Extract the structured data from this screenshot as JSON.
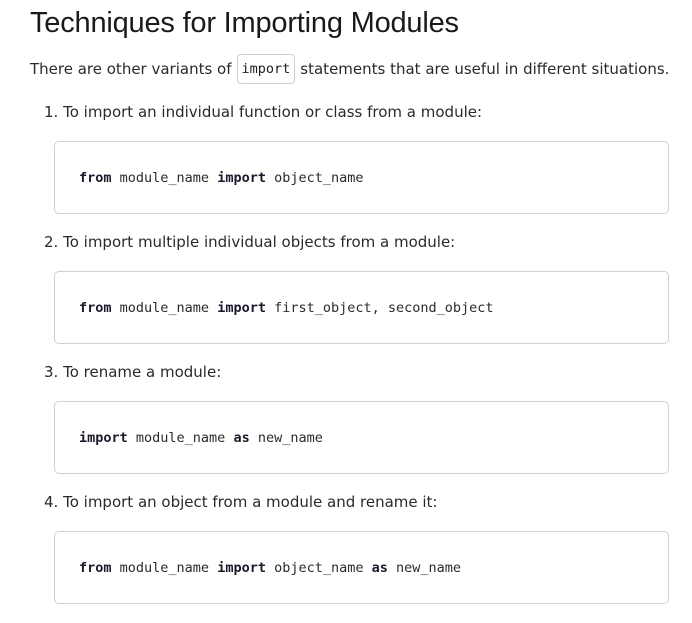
{
  "heading": "Techniques for Importing Modules",
  "intro": {
    "before": "There are other variants of",
    "code": "import",
    "after": "statements that are useful in different situations."
  },
  "steps": [
    {
      "number": "1.",
      "label": "To import an individual function or class from a module:",
      "code": [
        {
          "type": "kw",
          "text": "from"
        },
        {
          "type": "tok",
          "text": " module_name "
        },
        {
          "type": "kw",
          "text": "import"
        },
        {
          "type": "tok",
          "text": " object_name"
        }
      ]
    },
    {
      "number": "2.",
      "label": "To import multiple individual objects from a module:",
      "code": [
        {
          "type": "kw",
          "text": "from"
        },
        {
          "type": "tok",
          "text": " module_name "
        },
        {
          "type": "kw",
          "text": "import"
        },
        {
          "type": "tok",
          "text": " first_object, second_object"
        }
      ]
    },
    {
      "number": "3.",
      "label": "To rename a module:",
      "code": [
        {
          "type": "kw",
          "text": "import"
        },
        {
          "type": "tok",
          "text": " module_name "
        },
        {
          "type": "kw",
          "text": "as"
        },
        {
          "type": "tok",
          "text": " new_name"
        }
      ]
    },
    {
      "number": "4.",
      "label": "To import an object from a module and rename it:",
      "code": [
        {
          "type": "kw",
          "text": "from"
        },
        {
          "type": "tok",
          "text": " module_name "
        },
        {
          "type": "kw",
          "text": "import"
        },
        {
          "type": "tok",
          "text": " object_name "
        },
        {
          "type": "kw",
          "text": "as"
        },
        {
          "type": "tok",
          "text": " new_name"
        }
      ]
    }
  ]
}
